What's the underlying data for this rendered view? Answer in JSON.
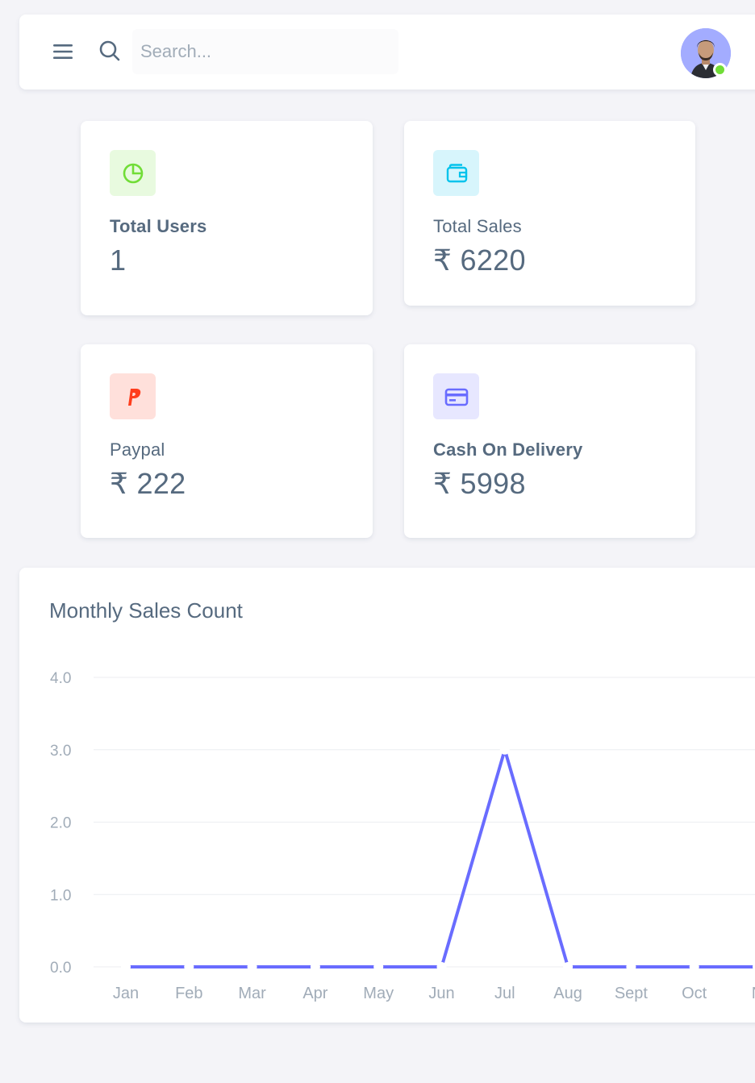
{
  "header": {
    "search_placeholder": "Search...",
    "avatar_status": "online",
    "status_color": "#71dd37"
  },
  "stats": [
    {
      "label": "Total Users",
      "value": "1",
      "icon": "pie-chart-icon",
      "color": "#71dd37",
      "bg": "#e8fadf"
    },
    {
      "label": "Total Sales",
      "value": "₹ 6220",
      "icon": "wallet-icon",
      "color": "#03c3ec",
      "bg": "#d7f5fc"
    },
    {
      "label": "Paypal",
      "value": "₹ 222",
      "icon": "paypal-icon",
      "color": "#ff3e1d",
      "bg": "#ffe0db"
    },
    {
      "label": "Cash On Delivery",
      "value": "₹ 5998",
      "icon": "credit-card-icon",
      "color": "#696cff",
      "bg": "#e7e7ff"
    }
  ],
  "chart": {
    "title": "Monthly Sales Count"
  },
  "chart_data": {
    "type": "line",
    "title": "Monthly Sales Count",
    "categories": [
      "Jan",
      "Feb",
      "Mar",
      "Apr",
      "May",
      "Jun",
      "Jul",
      "Aug",
      "Sept",
      "Oct",
      "N"
    ],
    "series": [
      {
        "values": [
          0,
          0,
          0,
          0,
          0,
          0,
          3,
          0,
          0,
          0,
          0
        ],
        "color": "#696cff"
      }
    ],
    "y_ticks": [
      "0.0",
      "1.0",
      "2.0",
      "3.0",
      "4.0"
    ],
    "ylim": [
      0,
      4
    ],
    "grid": true,
    "xlabel": "",
    "ylabel": ""
  }
}
